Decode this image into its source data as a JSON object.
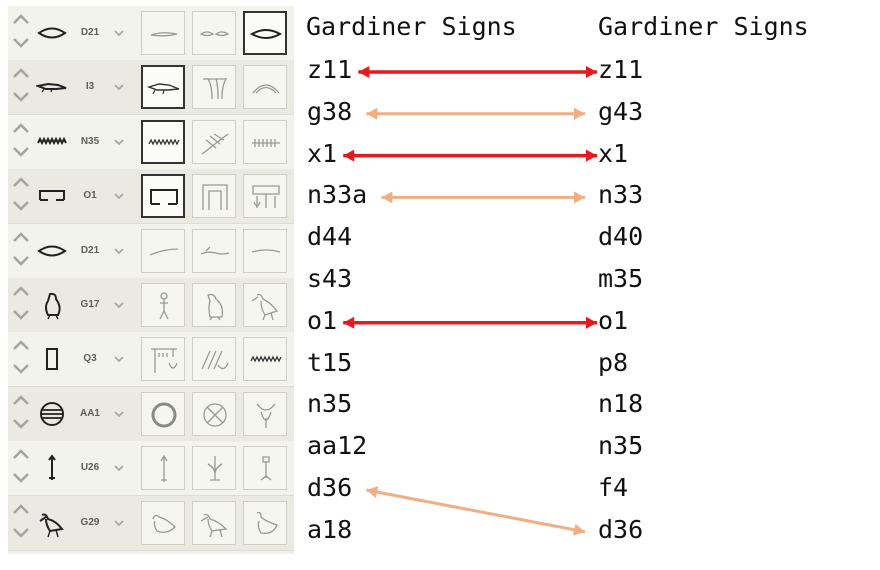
{
  "headers": {
    "left": "Gardiner Signs",
    "right": "Gardiner Signs"
  },
  "rows": [
    {
      "code": "D21",
      "glyph": "mouth",
      "cands": [
        "reed-leaf-glyph",
        "eyes-glyph",
        "mouth-glyph"
      ],
      "selected": 2
    },
    {
      "code": "I3",
      "glyph": "crocodile",
      "cands": [
        "crocodile-glyph",
        "fringed-cloth-glyph",
        "arc-glyph"
      ],
      "selected": 0
    },
    {
      "code": "N35",
      "glyph": "water",
      "cands": [
        "water-glyph",
        "branches-glyph",
        "comb-glyph"
      ],
      "selected": 0
    },
    {
      "code": "O1",
      "glyph": "house",
      "cands": [
        "house-glyph",
        "enclosure-glyph",
        "shrine-glyph"
      ],
      "selected": 0
    },
    {
      "code": "D21",
      "glyph": "mouth",
      "cands": [
        "stroke-glyph",
        "lying-figure-glyph",
        "curve-glyph"
      ],
      "selected": -1
    },
    {
      "code": "G17",
      "glyph": "owl",
      "cands": [
        "standing-man-glyph",
        "falcon-glyph",
        "heron-glyph"
      ],
      "selected": -1
    },
    {
      "code": "Q3",
      "glyph": "stool",
      "cands": [
        "canopy-glyph",
        "reeds-glyph",
        "water-glyph"
      ],
      "selected": -1
    },
    {
      "code": "AA1",
      "glyph": "placenta",
      "cands": [
        "ring-glyph",
        "crossed-circle-glyph",
        "vase-glyph"
      ],
      "selected": -1
    },
    {
      "code": "U26",
      "glyph": "drill",
      "cands": [
        "drill-glyph",
        "plant-glyph",
        "tool-glyph"
      ],
      "selected": -1
    },
    {
      "code": "G29",
      "glyph": "ibis",
      "cands": [
        "duck-glyph",
        "ibis-glyph",
        "goose-glyph"
      ],
      "selected": -1
    }
  ],
  "left_col": [
    "z11",
    "g38",
    "x1",
    "n33a",
    "d44",
    "s43",
    "o1",
    "t15",
    "n35",
    "aa12",
    "d36",
    "a18"
  ],
  "right_col": [
    "z11",
    "g43",
    "x1",
    "n33",
    "d40",
    "m35",
    "o1",
    "p8",
    "n18",
    "n35",
    "f4",
    "d36"
  ],
  "links": [
    {
      "from": 0,
      "to": 0,
      "kind": "exact"
    },
    {
      "from": 1,
      "to": 1,
      "kind": "near"
    },
    {
      "from": 2,
      "to": 2,
      "kind": "exact"
    },
    {
      "from": 3,
      "to": 3,
      "kind": "near"
    },
    {
      "from": 6,
      "to": 6,
      "kind": "exact"
    },
    {
      "from": 10,
      "to": 11,
      "kind": "near"
    }
  ],
  "colors": {
    "exact": "#e8191c",
    "near": "#f2ad83"
  }
}
